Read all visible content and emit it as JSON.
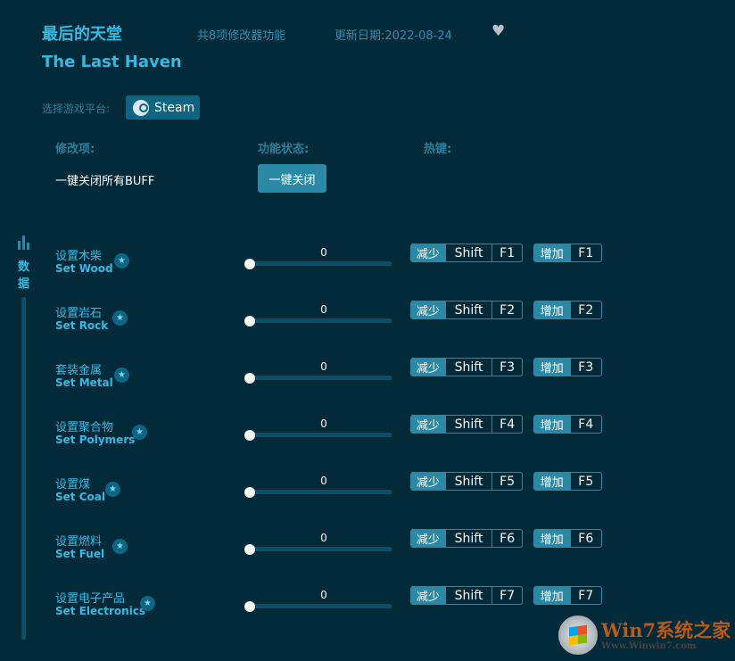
{
  "header": {
    "title_cn": "最后的天堂",
    "title_en": "The Last Haven",
    "feature_count": "共8项修改器功能",
    "update_date": "更新日期:2022-08-24",
    "favorite_icon": "heart-icon"
  },
  "platform": {
    "label": "选择游戏平台:",
    "selected": "Steam",
    "icon": "steam-icon"
  },
  "columns": {
    "item": "修改项:",
    "status": "功能状态:",
    "hotkey": "热键:"
  },
  "buff": {
    "label": "一键关闭所有BUFF",
    "button": "一键关闭"
  },
  "sidebar": {
    "tab_label_1": "数",
    "tab_label_2": "据",
    "icon": "bar-chart-icon"
  },
  "rows": [
    {
      "cn": "设置木柴",
      "en": "Set Wood",
      "value": "0",
      "dec_label": "减少",
      "mod": "Shift",
      "dec_key": "F1",
      "inc_label": "增加",
      "inc_key": "F1"
    },
    {
      "cn": "设置岩石",
      "en": "Set Rock",
      "value": "0",
      "dec_label": "减少",
      "mod": "Shift",
      "dec_key": "F2",
      "inc_label": "增加",
      "inc_key": "F2"
    },
    {
      "cn": "套装金属",
      "en": "Set Metal",
      "value": "0",
      "dec_label": "减少",
      "mod": "Shift",
      "dec_key": "F3",
      "inc_label": "增加",
      "inc_key": "F3"
    },
    {
      "cn": "设置聚合物",
      "en": "Set Polymers",
      "value": "0",
      "dec_label": "减少",
      "mod": "Shift",
      "dec_key": "F4",
      "inc_label": "增加",
      "inc_key": "F4"
    },
    {
      "cn": "设置煤",
      "en": "Set Coal",
      "value": "0",
      "dec_label": "减少",
      "mod": "Shift",
      "dec_key": "F5",
      "inc_label": "增加",
      "inc_key": "F5"
    },
    {
      "cn": "设置燃料",
      "en": "Set Fuel",
      "value": "0",
      "dec_label": "减少",
      "mod": "Shift",
      "dec_key": "F6",
      "inc_label": "增加",
      "inc_key": "F6"
    },
    {
      "cn": "设置电子产品",
      "en": "Set Electronics",
      "value": "0",
      "dec_label": "减少",
      "mod": "Shift",
      "dec_key": "F7",
      "inc_label": "增加",
      "inc_key": "F7"
    }
  ],
  "watermark": {
    "line1": "Win7系统之家",
    "line2": "Www.Winwin7.com"
  },
  "colors": {
    "background": "#022a38",
    "accent": "#35b9e3",
    "button": "#2a8aa6"
  }
}
